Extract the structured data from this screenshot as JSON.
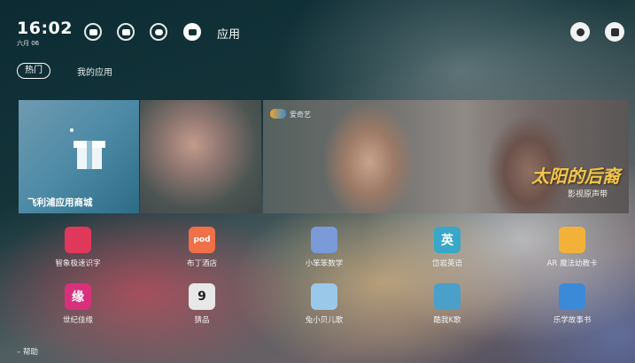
{
  "status": {
    "time": "16:02",
    "date": "六月 06"
  },
  "top_nav": {
    "items": [
      {
        "icon": "video-icon"
      },
      {
        "icon": "tv-icon"
      },
      {
        "icon": "gamepad-icon"
      },
      {
        "icon": "apps-icon",
        "label": "应用",
        "active": true
      }
    ],
    "right_icons": [
      "gear-icon",
      "input-source-icon"
    ]
  },
  "tabs": [
    {
      "label": "热门",
      "selected": true
    },
    {
      "label": "我的应用",
      "selected": false
    }
  ],
  "banners": {
    "store": {
      "label": "飞利浦应用商城"
    },
    "drama": {
      "logo_text": "爱奇艺",
      "title": "太阳的后裔",
      "subtitle": "影视原声带"
    }
  },
  "apps": [
    {
      "label": "智象极速识字",
      "icon": "owl-book-icon",
      "color": "#e0385a"
    },
    {
      "label": "布丁酒店",
      "icon": "pod-hotel-icon",
      "color": "#f0704a",
      "glyph": "pod"
    },
    {
      "label": "小笨笨数学",
      "icon": "cartoon-math-icon",
      "color": "#7a9ad8"
    },
    {
      "label": "岱岩英语",
      "icon": "english-book-icon",
      "color": "#3aa6c8",
      "glyph": "英"
    },
    {
      "label": "AR 魔法幼教卡",
      "icon": "frog-icon",
      "color": "#f2b23a"
    },
    {
      "label": "世纪佳缘",
      "icon": "jiayuan-icon",
      "color": "#d8307a",
      "glyph": "缘"
    },
    {
      "label": "猜品",
      "icon": "guess-icon",
      "color": "#e8e8e8",
      "glyph": "9"
    },
    {
      "label": "兔小贝儿歌",
      "icon": "bunny-icon",
      "color": "#9ac8e8"
    },
    {
      "label": "酷我K歌",
      "icon": "microphone-icon",
      "color": "#4aa0c8"
    },
    {
      "label": "乐学故事书",
      "icon": "storybook-icon",
      "color": "#3a8ad8"
    }
  ],
  "footer": {
    "help_label": "帮助"
  }
}
